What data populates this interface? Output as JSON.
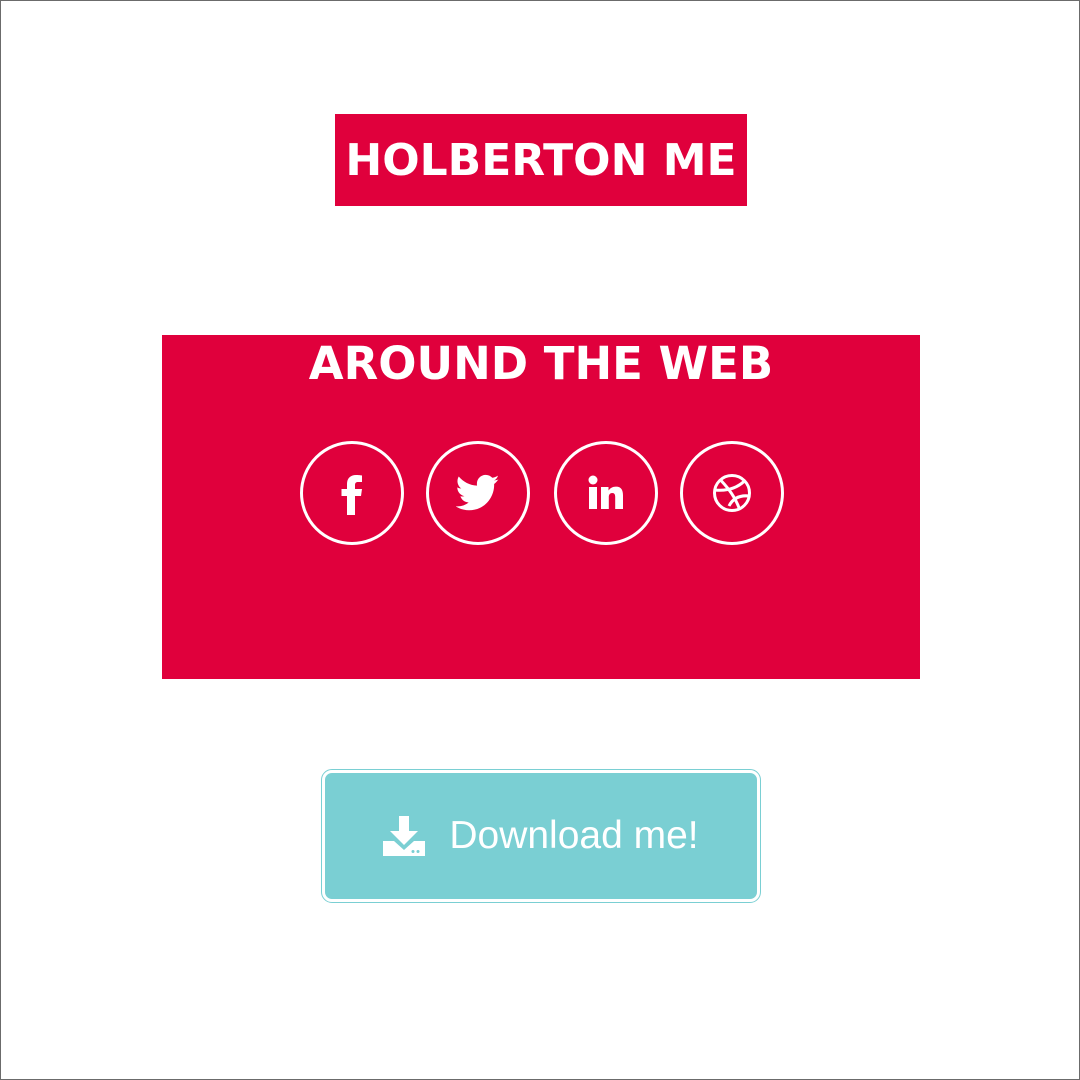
{
  "header": {
    "title": "HOLBERTON ME"
  },
  "around_the_web": {
    "heading": "AROUND THE WEB",
    "links": [
      {
        "name": "facebook",
        "icon": "facebook-icon"
      },
      {
        "name": "twitter",
        "icon": "twitter-icon"
      },
      {
        "name": "linkedin",
        "icon": "linkedin-icon"
      },
      {
        "name": "dribbble",
        "icon": "dribbble-icon"
      }
    ]
  },
  "download": {
    "label": "Download me!",
    "icon": "download-icon"
  },
  "colors": {
    "accent": "#e0003c",
    "button": "#7acfd3",
    "text_on_accent": "#ffffff"
  }
}
